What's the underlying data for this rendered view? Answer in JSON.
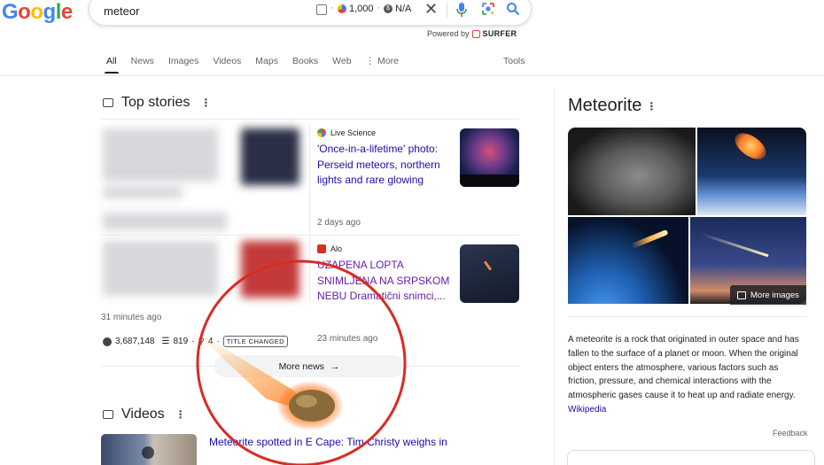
{
  "header": {
    "logo_text": "Google",
    "search_query": "meteor",
    "surfer_metrics": [
      "1,000",
      "N/A"
    ],
    "powered_by_label": "Powered by",
    "surfer_brand": "SURFER"
  },
  "nav": {
    "tabs": [
      "All",
      "News",
      "Images",
      "Videos",
      "Maps",
      "Books",
      "Web",
      "More"
    ],
    "active_tab": "All",
    "tools_label": "Tools"
  },
  "top_stories": {
    "title": "Top stories",
    "stories": [
      {
        "source": "Live Science",
        "headline": "'Once-in-a-lifetime' photo: Perseid meteors, northern lights and rare glowing arc...",
        "time": "2 days ago"
      },
      {
        "source": "Alo",
        "headline": "UZAPENA LOPTA SNIMLJENA NA SRPSKOM NEBU Dramatični snimci,...",
        "time": "23 minutes ago"
      }
    ],
    "blurred_story_time": "31 minutes ago",
    "meta": {
      "visits": "3,687,148",
      "words": "819",
      "keywords": "4",
      "badge": "TITLE CHANGED"
    },
    "more_news_label": "More news"
  },
  "videos": {
    "title": "Videos",
    "first_video_title": "Meteorite spotted in E Cape: Tim Christy weighs in"
  },
  "knowledge_panel": {
    "title": "Meteorite",
    "more_images_label": "More images",
    "description": "A meteorite is a rock that originated in outer space and has fallen to the surface of a planet or moon. When the original object enters the atmosphere, various factors such as friction, pressure, and chemical interactions with the atmospheric gases cause it to heat up and radiate energy.",
    "source_link": "Wikipedia",
    "feedback_label": "Feedback"
  },
  "colors": {
    "link": "#1a0dab",
    "visited": "#681da8",
    "overlay_ring": "#d92b24"
  }
}
